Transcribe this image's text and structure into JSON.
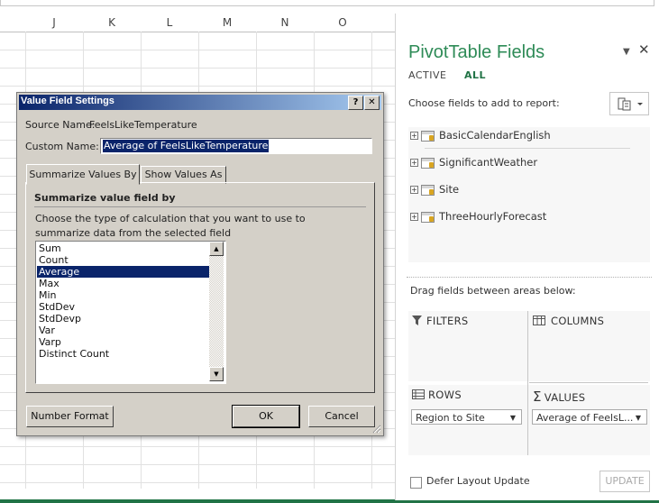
{
  "spreadsheet": {
    "columns": [
      "J",
      "K",
      "L",
      "M",
      "N",
      "O"
    ]
  },
  "pivot_pane": {
    "title": "PivotTable Fields",
    "tab_active": "ACTIVE",
    "tab_all": "ALL",
    "choose_label": "Choose fields to add to report:",
    "fields": [
      "BasicCalendarEnglish",
      "SignificantWeather",
      "Site",
      "ThreeHourlyForecast"
    ],
    "drag_label": "Drag fields between areas below:",
    "areas": {
      "filters": "FILTERS",
      "columns": "COLUMNS",
      "rows": "ROWS",
      "values": "VALUES"
    },
    "rows_value": "Region to Site",
    "values_value": "Average of FeelsL...",
    "defer_label": "Defer Layout Update",
    "update_label": "UPDATE"
  },
  "dialog": {
    "title": "Value Field Settings",
    "help_glyph": "?",
    "close_glyph": "✕",
    "source_label": "Source Name:",
    "source_value": "FeelsLikeTemperature",
    "custom_label": "Custom Name:",
    "custom_value": "Average of FeelsLikeTemperature",
    "tab_summarize": "Summarize Values By",
    "tab_show": "Show Values As",
    "section_heading": "Summarize value field by",
    "description": "Choose the type of calculation that you want to use to summarize data from the selected field",
    "calc_options": [
      "Sum",
      "Count",
      "Average",
      "Max",
      "Min",
      "StdDev",
      "StdDevp",
      "Var",
      "Varp",
      "Distinct Count"
    ],
    "selected_option": "Average",
    "number_format": "Number Format",
    "ok": "OK",
    "cancel": "Cancel"
  },
  "colors": {
    "excel_green": "#217346",
    "dialog_face": "#d4d0c8",
    "title_bar": "#0a246a",
    "pane_title": "#2e8b57"
  }
}
